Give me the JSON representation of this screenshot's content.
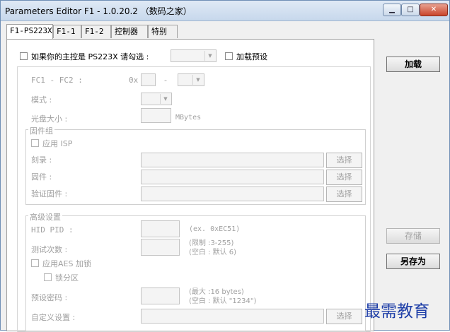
{
  "window": {
    "title": "Parameters Editor F1 - 1.0.20.2 （数码之家）"
  },
  "window_controls": {
    "minimize": "▁",
    "maximize": "□",
    "close": "✕"
  },
  "tabs": [
    {
      "label": "F1-PS223X"
    },
    {
      "label": "F1-1"
    },
    {
      "label": "F1-2"
    },
    {
      "label": "控制器"
    },
    {
      "label": "特别"
    }
  ],
  "main": {
    "main_checkbox_label": "如果你的主控是 PS223X 请勾选 :",
    "load_preset_label": "加载预设",
    "fc_label": "FC1 - FC2 :",
    "fc_prefix": "0x",
    "fc_dash": "-",
    "mode_label": "模式 :",
    "disk_size_label": "光盘大小 :",
    "disk_size_unit": "MBytes",
    "firmware_group": {
      "title": "固件组",
      "apply_isp_label": "应用 ISP",
      "burn_label": "刻录 :",
      "firmware_label": "固件 :",
      "verify_label": "验证固件 :",
      "select_label": "选择"
    },
    "advanced_group": {
      "title": "高级设置",
      "hid_pid_label": "HID PID :",
      "hid_pid_hint": "(ex. 0xEC51)",
      "test_count_label": "测试次数 :",
      "test_count_hint1": "(限制 :3-255)",
      "test_count_hint2": "(空白 : 默认 6)",
      "apply_aes_label": "应用AES 加锁",
      "lock_partition_label": "锁分区",
      "preset_password_label": "预设密码 :",
      "preset_password_hint1": "(最大 :16 bytes)",
      "preset_password_hint2": "(空白 : 默认 \"1234\")",
      "custom_settings_label": "自定义设置 :",
      "select_label": "选择"
    }
  },
  "right": {
    "load_button": "加载",
    "save_button": "存储",
    "save_as_button": "另存为"
  },
  "watermark": "最需教育"
}
